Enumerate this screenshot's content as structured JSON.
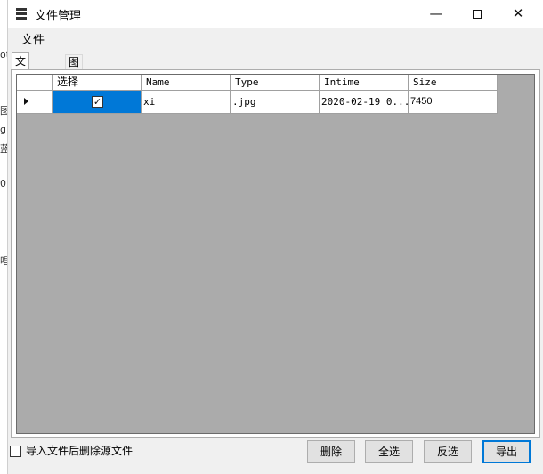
{
  "background_fragments": [
    "ot",
    "图",
    "g|",
    "蓝",
    "01",
    "唱"
  ],
  "window": {
    "title": "文件管理",
    "app_icon": "server-stack-icon",
    "controls": {
      "minimize": "—",
      "maximize_icon": "square-icon",
      "close": "✕"
    }
  },
  "menu": {
    "items": [
      {
        "label": "文件"
      }
    ]
  },
  "tabs": [
    {
      "label": "文件列表",
      "active": true
    },
    {
      "label": "图片浏览",
      "active": false
    }
  ],
  "grid": {
    "columns": [
      "选择",
      "Name",
      "Type",
      "Intime",
      "Size"
    ],
    "rows": [
      {
        "selected": true,
        "checked": true,
        "name": "xi",
        "type": ".jpg",
        "intime": "2020-02-19 0...",
        "size": "7450"
      }
    ],
    "selection_color": "#0078d7",
    "empty_area_color": "#ababab"
  },
  "footer": {
    "checkbox_label": "导入文件后删除源文件",
    "checkbox_checked": false,
    "buttons": {
      "delete": "删除",
      "select_all": "全选",
      "invert": "反选",
      "export": "导出"
    }
  }
}
